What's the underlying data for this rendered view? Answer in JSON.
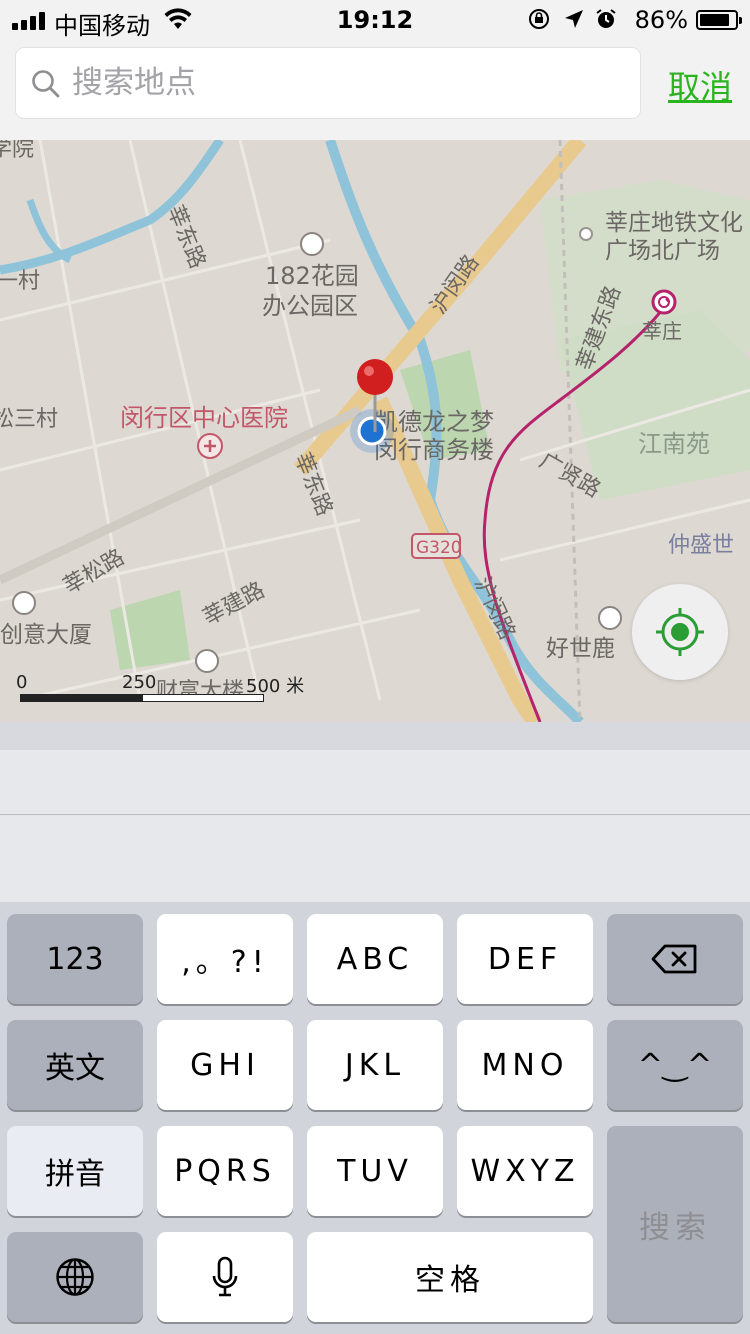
{
  "status_bar": {
    "carrier": "中国移动",
    "time": "19:12",
    "battery_percent": "86%",
    "battery_level": 0.86,
    "icons": [
      "signal-icon",
      "wifi-icon",
      "orientation-lock-icon",
      "location-arrow-icon",
      "alarm-icon",
      "battery-icon"
    ]
  },
  "search": {
    "placeholder": "搜索地点",
    "value": "",
    "cancel_label": "取消"
  },
  "map": {
    "labels": {
      "school_fragment": "学院",
      "xindong_road": "莘东路",
      "garden_line1": "182花园",
      "garden_line2": "办公园区",
      "hukuang_road_top": "沪闵路",
      "xinzhuang_metro_line1": "莘庄地铁文化",
      "xinzhuang_metro_line2": "广场北广场",
      "xinjian_east_road": "莘建东路",
      "xinzhuang": "莘庄",
      "village_left": "一村",
      "songsan_village": "松三村",
      "hospital": "闵行区中心医院",
      "kaide_line1": "凯德龙之梦",
      "kaide_line2": "闵行商务楼",
      "jiangnan_yuan": "江南苑",
      "xindong_road_2": "莘东路",
      "guangxian_road": "广贤路",
      "g320": "G320",
      "zhongsheng": "仲盛世",
      "xinsong_road": "莘松路",
      "xinjian_road": "莘建路",
      "hukuang_road_bottom": "沪闵路",
      "haoshilu": "好世鹿",
      "chuangyi": "创意大厦",
      "caifu": "财富大楼"
    },
    "scale": {
      "start": "0",
      "mid": "250",
      "end": "500 米"
    },
    "colors": {
      "background": "#ddd9d2",
      "major_road": "#e8c98e",
      "river": "#8ec3d9",
      "park": "#bcd6b0",
      "metro": "#b4236c",
      "pin": "#d11f1f",
      "current_location": "#1e73d2",
      "accent_green": "#2ab51e"
    }
  },
  "keyboard": {
    "keys": {
      "num": "123",
      "punct": ",。?!",
      "abc": "ABC",
      "def": "DEF",
      "english": "英文",
      "ghi": "GHI",
      "jkl": "JKL",
      "mno": "MNO",
      "emoji": "^‿^",
      "pinyin": "拼音",
      "pqrs": "PQRS",
      "tuv": "TUV",
      "wxyz": "WXYZ",
      "search": "搜索",
      "space": "空格"
    },
    "icons": [
      "backspace-icon",
      "globe-icon",
      "microphone-icon"
    ]
  }
}
